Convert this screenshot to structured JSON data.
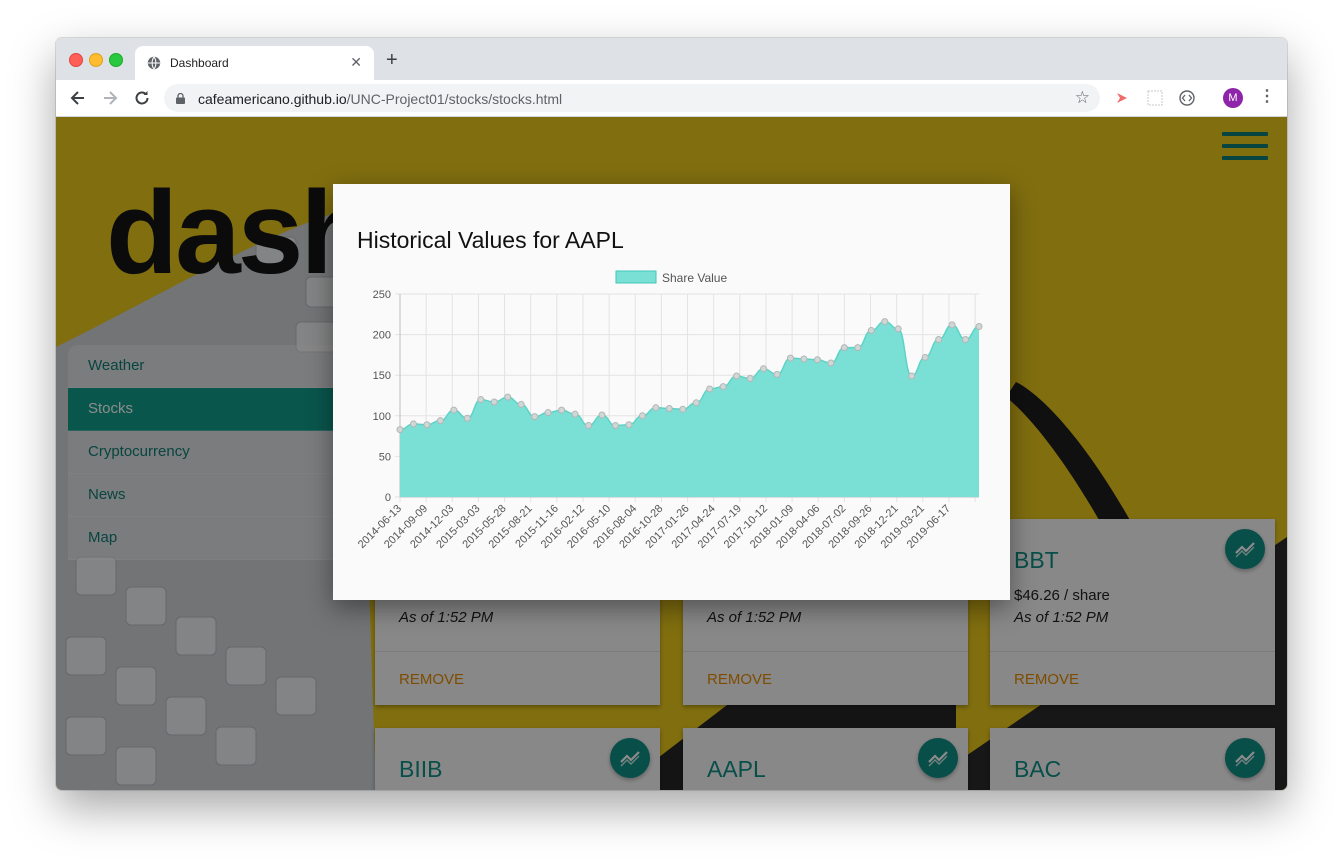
{
  "browser": {
    "tab_title": "Dashboard",
    "new_tab": "+",
    "url_domain": "cafeamericano.github.io",
    "url_path": "/UNC-Project01/stocks/stocks.html",
    "avatar_letter": "M"
  },
  "header": {
    "brand": "dash"
  },
  "sidebar": {
    "items": [
      {
        "label": "Weather"
      },
      {
        "label": "Stocks"
      },
      {
        "label": "Cryptocurrency"
      },
      {
        "label": "News"
      },
      {
        "label": "Map"
      }
    ],
    "active": "Stocks"
  },
  "cards": [
    {
      "symbol": "",
      "price": "",
      "as_of": "As of 1:52 PM",
      "remove": "REMOVE"
    },
    {
      "symbol": "",
      "price": "",
      "as_of": "As of 1:52 PM",
      "remove": "REMOVE"
    },
    {
      "symbol": "BBT",
      "price": "$46.26 / share",
      "as_of": "As of 1:52 PM",
      "remove": "REMOVE"
    },
    {
      "symbol": "BIIB",
      "price": "",
      "as_of": "",
      "remove": ""
    },
    {
      "symbol": "AAPL",
      "price": "",
      "as_of": "",
      "remove": ""
    },
    {
      "symbol": "BAC",
      "price": "",
      "as_of": "",
      "remove": ""
    }
  ],
  "modal": {
    "title": "Historical Values for AAPL"
  },
  "colors": {
    "accent": "#119d8c",
    "area_fill": "#7ae0d6",
    "remove": "#e68a00",
    "background": "#e7c61a"
  },
  "chart_data": {
    "type": "area",
    "legend": "Share Value",
    "legend_position": "top",
    "ylim": [
      0,
      250
    ],
    "yticks": [
      0,
      50,
      100,
      150,
      200,
      250
    ],
    "grid": true,
    "x_tick_labels": [
      "2014-06-13",
      "2014-09-09",
      "2014-12-03",
      "2015-03-03",
      "2015-05-28",
      "2015-08-21",
      "2015-11-16",
      "2016-02-12",
      "2016-05-10",
      "2016-08-04",
      "2016-10-28",
      "2017-01-26",
      "2017-04-24",
      "2017-07-19",
      "2017-10-12",
      "2018-01-09",
      "2018-04-06",
      "2018-07-02",
      "2018-09-26",
      "2018-12-21",
      "2019-03-21",
      "2019-06-17"
    ],
    "series": [
      {
        "name": "Share Value",
        "values": [
          83,
          90,
          89,
          94,
          107,
          97,
          120,
          117,
          123,
          114,
          99,
          104,
          107,
          102,
          88,
          101,
          88,
          89,
          100,
          110,
          109,
          108,
          116,
          133,
          136,
          149,
          146,
          158,
          151,
          171,
          170,
          169,
          165,
          184,
          184,
          205,
          216,
          207,
          149,
          172,
          194,
          212,
          194,
          210
        ]
      }
    ]
  }
}
